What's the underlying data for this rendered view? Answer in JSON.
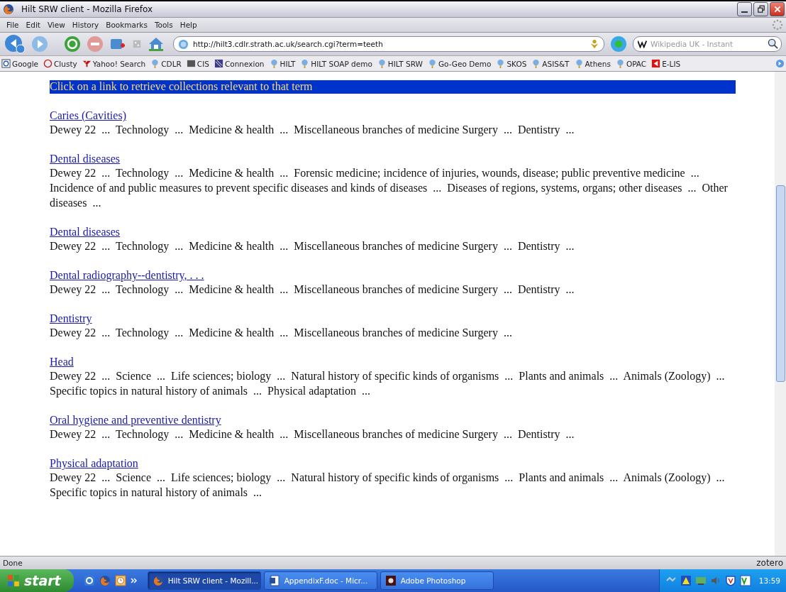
{
  "window": {
    "title": "Hilt SRW client - Mozilla Firefox"
  },
  "menu": [
    "File",
    "Edit",
    "View",
    "History",
    "Bookmarks",
    "Tools",
    "Help"
  ],
  "address": {
    "value": "http://hilt3.cdlr.strath.ac.uk/search.cgi?term=teeth"
  },
  "search": {
    "placeholder": "Wikipedia UK - Instant"
  },
  "bookmarks": [
    {
      "label": "Google",
      "kind": "google"
    },
    {
      "label": "Clusty",
      "kind": "clusty"
    },
    {
      "label": "Yahoo! Search",
      "kind": "yahoo"
    },
    {
      "label": "CDLR",
      "kind": "globe"
    },
    {
      "label": "CIS",
      "kind": "cis"
    },
    {
      "label": "Connexion",
      "kind": "connexion"
    },
    {
      "label": "HILT",
      "kind": "globe"
    },
    {
      "label": "HILT SOAP demo",
      "kind": "globe"
    },
    {
      "label": "HILT SRW",
      "kind": "globe"
    },
    {
      "label": "Go-Geo Demo",
      "kind": "globe"
    },
    {
      "label": "SKOS",
      "kind": "globe"
    },
    {
      "label": "ASIS&T",
      "kind": "globe"
    },
    {
      "label": "Athens",
      "kind": "globe"
    },
    {
      "label": "OPAC",
      "kind": "globe"
    },
    {
      "label": "E-LIS",
      "kind": "elis"
    }
  ],
  "page": {
    "banner": "Click on a link to retrieve collections relevant to that term",
    "results": [
      {
        "term": "Caries (Cavities)",
        "path": "Dewey 22  ...  Technology  ...  Medicine & health  ...  Miscellaneous branches of medicine Surgery  ...  Dentistry  ..."
      },
      {
        "term": "Dental diseases",
        "path": "Dewey 22  ...  Technology  ...  Medicine & health  ...  Forensic medicine; incidence of injuries, wounds, disease; public preventive medicine  ...  Incidence of and public measures to prevent specific diseases and kinds of diseases  ...  Diseases of regions, systems, organs; other diseases  ...  Other diseases  ..."
      },
      {
        "term": "Dental diseases",
        "path": "Dewey 22  ...  Technology  ...  Medicine & health  ...  Miscellaneous branches of medicine Surgery  ...  Dentistry  ..."
      },
      {
        "term": "Dental radiography--dentistry, . . .",
        "path": "Dewey 22  ...  Technology  ...  Medicine & health  ...  Miscellaneous branches of medicine Surgery  ...  Dentistry  ..."
      },
      {
        "term": "Dentistry",
        "path": "Dewey 22  ...  Technology  ...  Medicine & health  ...  Miscellaneous branches of medicine Surgery  ..."
      },
      {
        "term": "Head",
        "path": "Dewey 22  ...  Science  ...  Life sciences; biology  ...  Natural history of specific kinds of organisms  ...  Plants and animals  ...  Animals (Zoology)  ...  Specific topics in natural history of animals  ...  Physical adaptation  ..."
      },
      {
        "term": "Oral hygiene and preventive dentistry",
        "path": "Dewey 22  ...  Technology  ...  Medicine & health  ...  Miscellaneous branches of medicine Surgery  ...  Dentistry  ..."
      },
      {
        "term": "Physical adaptation",
        "path": "Dewey 22  ...  Science  ...  Life sciences; biology  ...  Natural history of specific kinds of organisms  ...  Plants and animals  ...  Animals (Zoology)  ...  Specific topics in natural history of animals  ..."
      }
    ]
  },
  "status_bar": {
    "text": "Done",
    "zotero": "zotero"
  },
  "taskbar": {
    "start": "start",
    "tasks": [
      {
        "label": "Hilt SRW client - Mozill...",
        "kind": "firefox",
        "selected": true
      },
      {
        "label": "AppendixF.doc - Micr...",
        "kind": "word",
        "selected": false
      },
      {
        "label": "Adobe Photoshop",
        "kind": "photoshop",
        "selected": false
      }
    ],
    "clock": "13:59"
  }
}
